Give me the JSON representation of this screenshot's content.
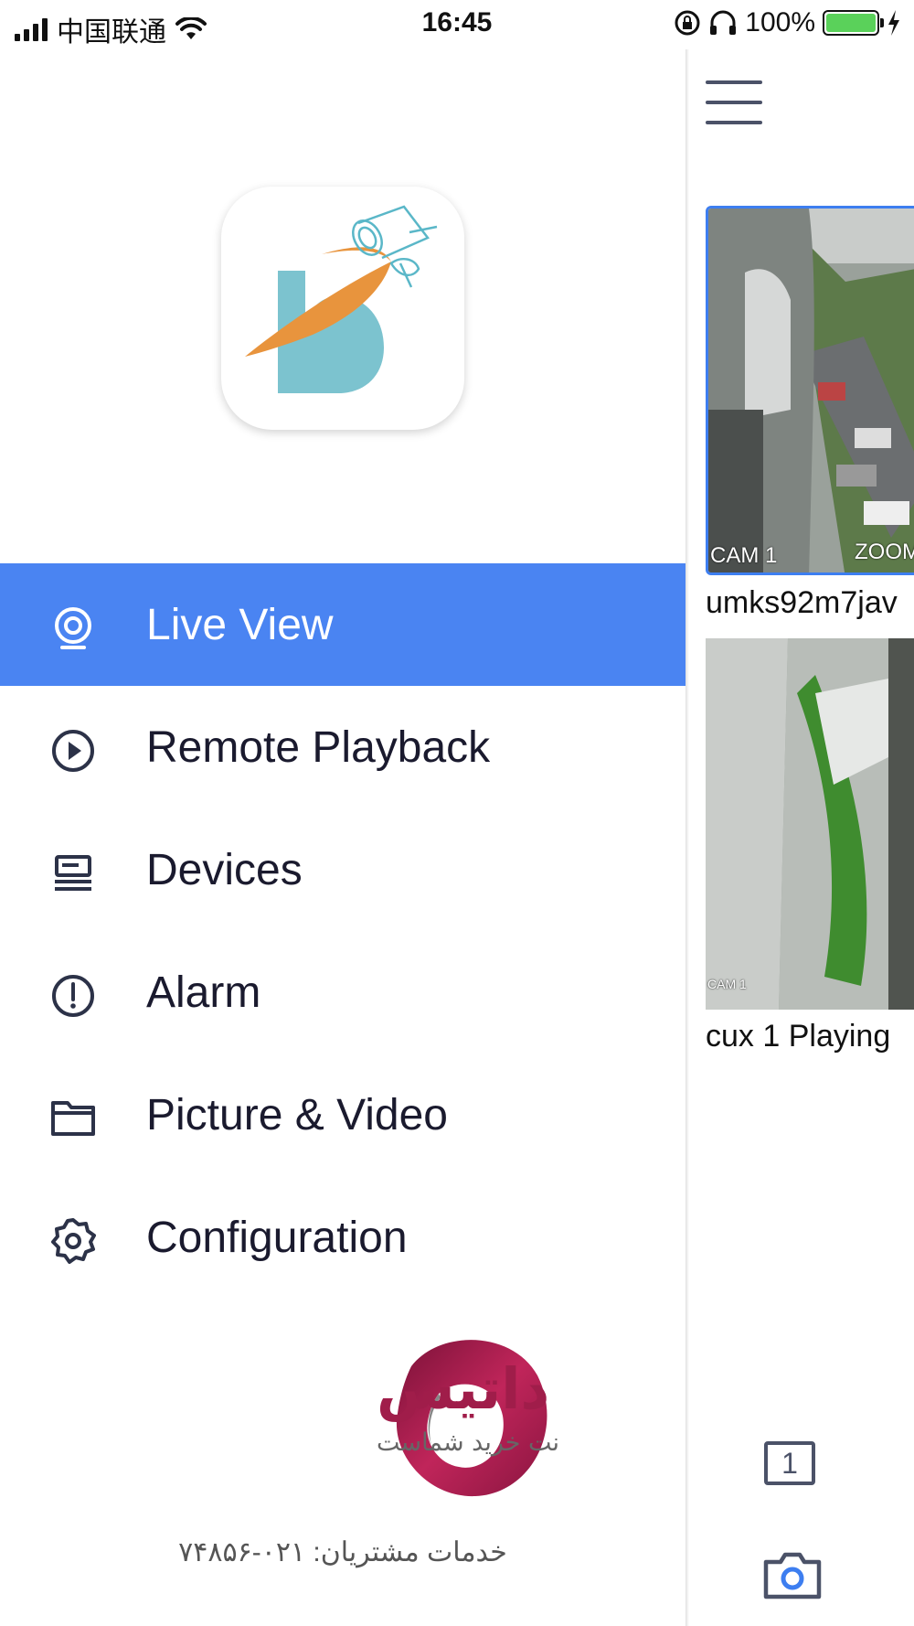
{
  "status_bar": {
    "carrier": "中国联通",
    "time": "16:45",
    "battery": "100%"
  },
  "menu": [
    {
      "label": "Live View",
      "icon": "live-view-camera-icon",
      "active": true
    },
    {
      "label": "Remote Playback",
      "icon": "playback-icon",
      "active": false
    },
    {
      "label": "Devices",
      "icon": "devices-icon",
      "active": false
    },
    {
      "label": "Alarm",
      "icon": "alarm-icon",
      "active": false
    },
    {
      "label": "Picture & Video",
      "icon": "folder-icon",
      "active": false
    },
    {
      "label": "Configuration",
      "icon": "gear-icon",
      "active": false
    }
  ],
  "brand": {
    "name": "داتیس",
    "tagline": "ضمانت خرید شماست",
    "support": "خدمات مشتریان: ۰۲۱-۷۴۸۵۶"
  },
  "cameras": [
    {
      "title": "umks92m7jav",
      "overlay_left": "CAM 1",
      "overlay_right": "ZOOM"
    },
    {
      "title": "cux 1 Playing",
      "overlay_left": "CAM 1"
    }
  ],
  "toolbar": {
    "channel_count": "1"
  },
  "colors": {
    "accent": "#4a84f2",
    "icon": "#4b5268",
    "brand": "#b0204f"
  }
}
